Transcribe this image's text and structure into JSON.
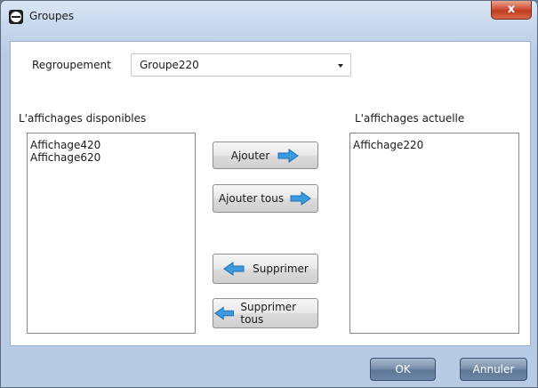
{
  "window": {
    "title": "Groupes",
    "close_label": "x"
  },
  "regroupement": {
    "label": "Regroupement",
    "selected": "Groupe220"
  },
  "available": {
    "label": "L'affichages disponibles",
    "items": [
      "Affichage420",
      "Affichage620"
    ]
  },
  "current": {
    "label": "L'affichages actuelle",
    "items": [
      "Affichage220"
    ]
  },
  "actions": {
    "add": "Ajouter",
    "add_all": "Ajouter tous",
    "remove": "Supprimer",
    "remove_all": "Supprimer tous"
  },
  "footer": {
    "ok": "OK",
    "cancel": "Annuler"
  },
  "icons": {
    "arrow_right": "arrow-right-icon",
    "arrow_left": "arrow-left-icon",
    "arrow_color": "#3a9be0"
  }
}
